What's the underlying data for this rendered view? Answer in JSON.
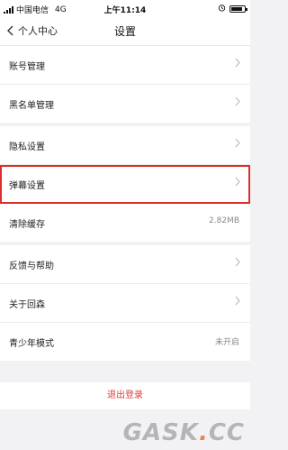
{
  "status_bar": {
    "carrier": "中国电信",
    "network": "4G",
    "time": "上午11:14",
    "battery_level": 0.85
  },
  "nav": {
    "back_label": "个人中心",
    "title": "设置"
  },
  "groups": [
    {
      "rows": [
        {
          "label": "账号管理"
        },
        {
          "label": "黑名单管理"
        }
      ]
    },
    {
      "rows": [
        {
          "label": "隐私设置"
        },
        {
          "label": "弹幕设置"
        },
        {
          "label": "清除缓存",
          "value": "2.82MB"
        }
      ]
    },
    {
      "rows": [
        {
          "label": "反馈与帮助"
        },
        {
          "label": "关于回森"
        },
        {
          "label": "青少年模式",
          "value": "未开启"
        }
      ]
    }
  ],
  "logout_label": "退出登录",
  "watermark": {
    "main": "GASK",
    "dot": ".",
    "suffix": "CC"
  },
  "colors": {
    "highlight": "#d9302c",
    "logout": "#e23b3b"
  }
}
